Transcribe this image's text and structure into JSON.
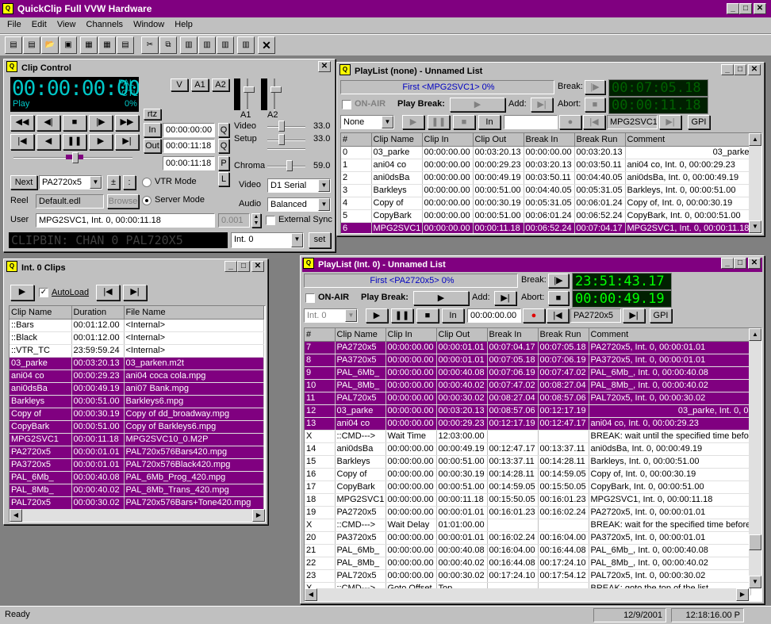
{
  "app": {
    "title": "QuickClip Full VVW Hardware"
  },
  "menu": [
    "File",
    "Edit",
    "View",
    "Channels",
    "Window",
    "Help"
  ],
  "toolbar": [
    "PL",
    "PL",
    "open",
    "save",
    "AB",
    "AB",
    "CLIPS",
    "cut",
    "copy",
    "paste",
    "paste2",
    "paste3",
    "x"
  ],
  "clip_control": {
    "title": "Clip Control",
    "timecode": "00:00:00:00",
    "format": "PAL",
    "ctl": "CTL",
    "pct": "0%",
    "mode": "Play",
    "v_label": "V",
    "a1_label": "A1",
    "a2_label": "A2",
    "rtz": "rtz",
    "in_label": "In",
    "out_label": "Out",
    "in_tc": "00:00:00:00",
    "out_tc": "00:00:11:18",
    "dur_tc": "00:00:11:18",
    "q1": "Q",
    "q2": "Q",
    "p": "P",
    "l": "L",
    "meter_a1": "A1",
    "meter_a2": "A2",
    "video_label": "Video",
    "video_val": "33.0",
    "setup_label": "Setup",
    "setup_val": "33.0",
    "chroma_label": "Chroma",
    "chroma_val": "59.0",
    "next": "Next",
    "clip_select": "PA2720x5",
    "plus": "±",
    "colon": ":",
    "vtr_mode": "VTR Mode",
    "server_mode": "Server Mode",
    "reel_label": "Reel",
    "reel_value": "Default.edl",
    "browse": "Browse",
    "video_sel_label": "Video",
    "video_sel": "D1 Serial",
    "audio_sel_label": "Audio",
    "audio_sel": "Balanced",
    "user_label": "User",
    "user_value": "MPG2SVC1, Int.  0, 00:00:11.18",
    "speed": "0.001",
    "external_sync": "External Sync",
    "clipbin": "CLIPBIN: CHAN 0 PAL720X5",
    "channel": "Int.  0",
    "set": "set"
  },
  "playlist1": {
    "title": "PlayList (none)  - Unnamed List",
    "first": "First <MPG2SVC1> 0%",
    "break_label": "Break:",
    "abort_label": "Abort:",
    "tc1": "00:07:05.18",
    "tc2": "00:00:11.18",
    "on_air": "ON-AIR",
    "play_break": "Play Break:",
    "add": "Add:",
    "none_sel": "None",
    "in": "In",
    "clip": "MPG2SVC1",
    "gpi": "GPI",
    "columns": [
      "#",
      "Clip Name",
      "Clip In",
      "Clip Out",
      "Break In",
      "Break Run",
      "Comment"
    ],
    "rows": [
      [
        "0",
        "03_parke",
        "00:00:00.00",
        "00:03:20.13",
        "00:00:00.00",
        "00:03:20.13",
        "03_parke,"
      ],
      [
        "1",
        "ani04 co",
        "00:00:00.00",
        "00:00:29.23",
        "00:03:20.13",
        "00:03:50.11",
        "ani04 co, Int.  0, 00:00:29.23"
      ],
      [
        "2",
        "ani0dsBa",
        "00:00:00.00",
        "00:00:49.19",
        "00:03:50.11",
        "00:04:40.05",
        "ani0dsBa, Int.  0, 00:00:49.19"
      ],
      [
        "3",
        "Barkleys",
        "00:00:00.00",
        "00:00:51.00",
        "00:04:40.05",
        "00:05:31.05",
        "Barkleys, Int.  0, 00:00:51.00"
      ],
      [
        "4",
        "Copy of",
        "00:00:00.00",
        "00:00:30.19",
        "00:05:31.05",
        "00:06:01.24",
        "Copy of, Int.  0, 00:00:30.19"
      ],
      [
        "5",
        "CopyBark",
        "00:00:00.00",
        "00:00:51.00",
        "00:06:01.24",
        "00:06:52.24",
        "CopyBark, Int.  0, 00:00:51.00"
      ],
      [
        "6",
        "MPG2SVC1",
        "00:00:00.00",
        "00:00:11.18",
        "00:06:52.24",
        "00:07:04.17",
        "MPG2SVC1, Int.  0, 00:00:11.18"
      ]
    ]
  },
  "clips": {
    "title": "Int.  0 Clips",
    "autoload": "AutoLoad",
    "columns": [
      "Clip Name",
      "Duration",
      "File Name"
    ],
    "rows": [
      [
        "::Bars",
        "00:01:12.00",
        "<Internal>"
      ],
      [
        "::Black",
        "00:01:12.00",
        "<Internal>"
      ],
      [
        "::VTR_TC",
        "23:59:59.24",
        "<Internal>"
      ],
      [
        "03_parke",
        "00:03:20.13",
        "03_parken.m2t"
      ],
      [
        "ani04 co",
        "00:00:29.23",
        "ani04 coca cola.mpg"
      ],
      [
        "ani0dsBa",
        "00:00:49.19",
        "ani07 Bank.mpg"
      ],
      [
        "Barkleys",
        "00:00:51.00",
        "Barkleys6.mpg"
      ],
      [
        "Copy of",
        "00:00:30.19",
        "Copy of dd_broadway.mpg"
      ],
      [
        "CopyBark",
        "00:00:51.00",
        "Copy of Barkleys6.mpg"
      ],
      [
        "MPG2SVC1",
        "00:00:11.18",
        "MPG2SVC10_0.M2P"
      ],
      [
        "PA2720x5",
        "00:00:01.01",
        "PAL720x576Bars420.mpg"
      ],
      [
        "PA3720x5",
        "00:00:01.01",
        "PAL720x576Black420.mpg"
      ],
      [
        "PAL_6Mb_",
        "00:00:40.08",
        "PAL_6Mb_Prog_420.mpg"
      ],
      [
        "PAL_8Mb_",
        "00:00:40.02",
        "PAL_8Mb_Trans_420.mpg"
      ],
      [
        "PAL720x5",
        "00:00:30.02",
        "PAL720x576Bars+Tone420.mpg"
      ]
    ]
  },
  "playlist2": {
    "title": "PlayList (Int.  0)  - Unnamed List",
    "first": "First <PA2720x5> 0%",
    "break_label": "Break:",
    "abort_label": "Abort:",
    "tc1": "23:51:43.17",
    "tc2": "00:00:49.19",
    "on_air": "ON-AIR",
    "play_break": "Play Break:",
    "add": "Add:",
    "channel_sel": "Int.  0",
    "in": "In",
    "tc_field": "00:00:00.00",
    "clip": "PA2720x5",
    "gpi": "GPI",
    "columns": [
      "#",
      "Clip Name",
      "Clip In",
      "Clip Out",
      "Break In",
      "Break Run",
      "Comment"
    ],
    "rows": [
      [
        "7",
        "PA2720x5",
        "00:00:00.00",
        "00:00:01.01",
        "00:07:04.17",
        "00:07:05.18",
        "PA2720x5, Int.  0, 00:00:01.01"
      ],
      [
        "8",
        "PA3720x5",
        "00:00:00.00",
        "00:00:01.01",
        "00:07:05.18",
        "00:07:06.19",
        "PA3720x5, Int.  0, 00:00:01.01"
      ],
      [
        "9",
        "PAL_6Mb_",
        "00:00:00.00",
        "00:00:40.08",
        "00:07:06.19",
        "00:07:47.02",
        "PAL_6Mb_, Int.  0, 00:00:40.08"
      ],
      [
        "10",
        "PAL_8Mb_",
        "00:00:00.00",
        "00:00:40.02",
        "00:07:47.02",
        "00:08:27.04",
        "PAL_8Mb_, Int.  0, 00:00:40.02"
      ],
      [
        "11",
        "PAL720x5",
        "00:00:00.00",
        "00:00:30.02",
        "00:08:27.04",
        "00:08:57.06",
        "PAL720x5, Int.  0, 00:00:30.02"
      ],
      [
        "12",
        "03_parke",
        "00:00:00.00",
        "00:03:20.13",
        "00:08:57.06",
        "00:12:17.19",
        "03_parke, Int.  0, 0"
      ],
      [
        "13",
        "ani04 co",
        "00:00:00.00",
        "00:00:29.23",
        "00:12:17.19",
        "00:12:47.17",
        "ani04 co, Int.  0, 00:00:29.23"
      ],
      [
        "X",
        "::CMD--->",
        "Wait Time",
        "12:03:00.00",
        "",
        "",
        "BREAK: wait until the specified time before"
      ],
      [
        "14",
        "ani0dsBa",
        "00:00:00.00",
        "00:00:49.19",
        "00:12:47.17",
        "00:13:37.11",
        "ani0dsBa, Int.  0, 00:00:49.19"
      ],
      [
        "15",
        "Barkleys",
        "00:00:00.00",
        "00:00:51.00",
        "00:13:37.11",
        "00:14:28.11",
        "Barkleys, Int.  0, 00:00:51.00"
      ],
      [
        "16",
        "Copy of",
        "00:00:00.00",
        "00:00:30.19",
        "00:14:28.11",
        "00:14:59.05",
        "Copy of, Int.  0, 00:00:30.19"
      ],
      [
        "17",
        "CopyBark",
        "00:00:00.00",
        "00:00:51.00",
        "00:14:59.05",
        "00:15:50.05",
        "CopyBark, Int.  0, 00:00:51.00"
      ],
      [
        "18",
        "MPG2SVC1",
        "00:00:00.00",
        "00:00:11.18",
        "00:15:50.05",
        "00:16:01.23",
        "MPG2SVC1, Int.  0, 00:00:11.18"
      ],
      [
        "19",
        "PA2720x5",
        "00:00:00.00",
        "00:00:01.01",
        "00:16:01.23",
        "00:16:02.24",
        "PA2720x5, Int.  0, 00:00:01.01"
      ],
      [
        "X",
        "::CMD--->",
        "Wait Delay",
        "01:01:00.00",
        "",
        "",
        "BREAK: wait for the specified time before c"
      ],
      [
        "20",
        "PA3720x5",
        "00:00:00.00",
        "00:00:01.01",
        "00:16:02.24",
        "00:16:04.00",
        "PA3720x5, Int.  0, 00:00:01.01"
      ],
      [
        "21",
        "PAL_6Mb_",
        "00:00:00.00",
        "00:00:40.08",
        "00:16:04.00",
        "00:16:44.08",
        "PAL_6Mb_, Int.  0, 00:00:40.08"
      ],
      [
        "22",
        "PAL_8Mb_",
        "00:00:00.00",
        "00:00:40.02",
        "00:16:44.08",
        "00:17:24.10",
        "PAL_8Mb_, Int.  0, 00:00:40.02"
      ],
      [
        "23",
        "PAL720x5",
        "00:00:00.00",
        "00:00:30.02",
        "00:17:24.10",
        "00:17:54.12",
        "PAL720x5, Int.  0, 00:00:30.02"
      ],
      [
        "X",
        "::CMD--->",
        "Goto Offset",
        "Top",
        "",
        "",
        "BREAK: goto the top of the list"
      ]
    ]
  },
  "status": {
    "ready": "Ready",
    "date": "12/9/2001",
    "time": "12:18:16.00 P"
  }
}
